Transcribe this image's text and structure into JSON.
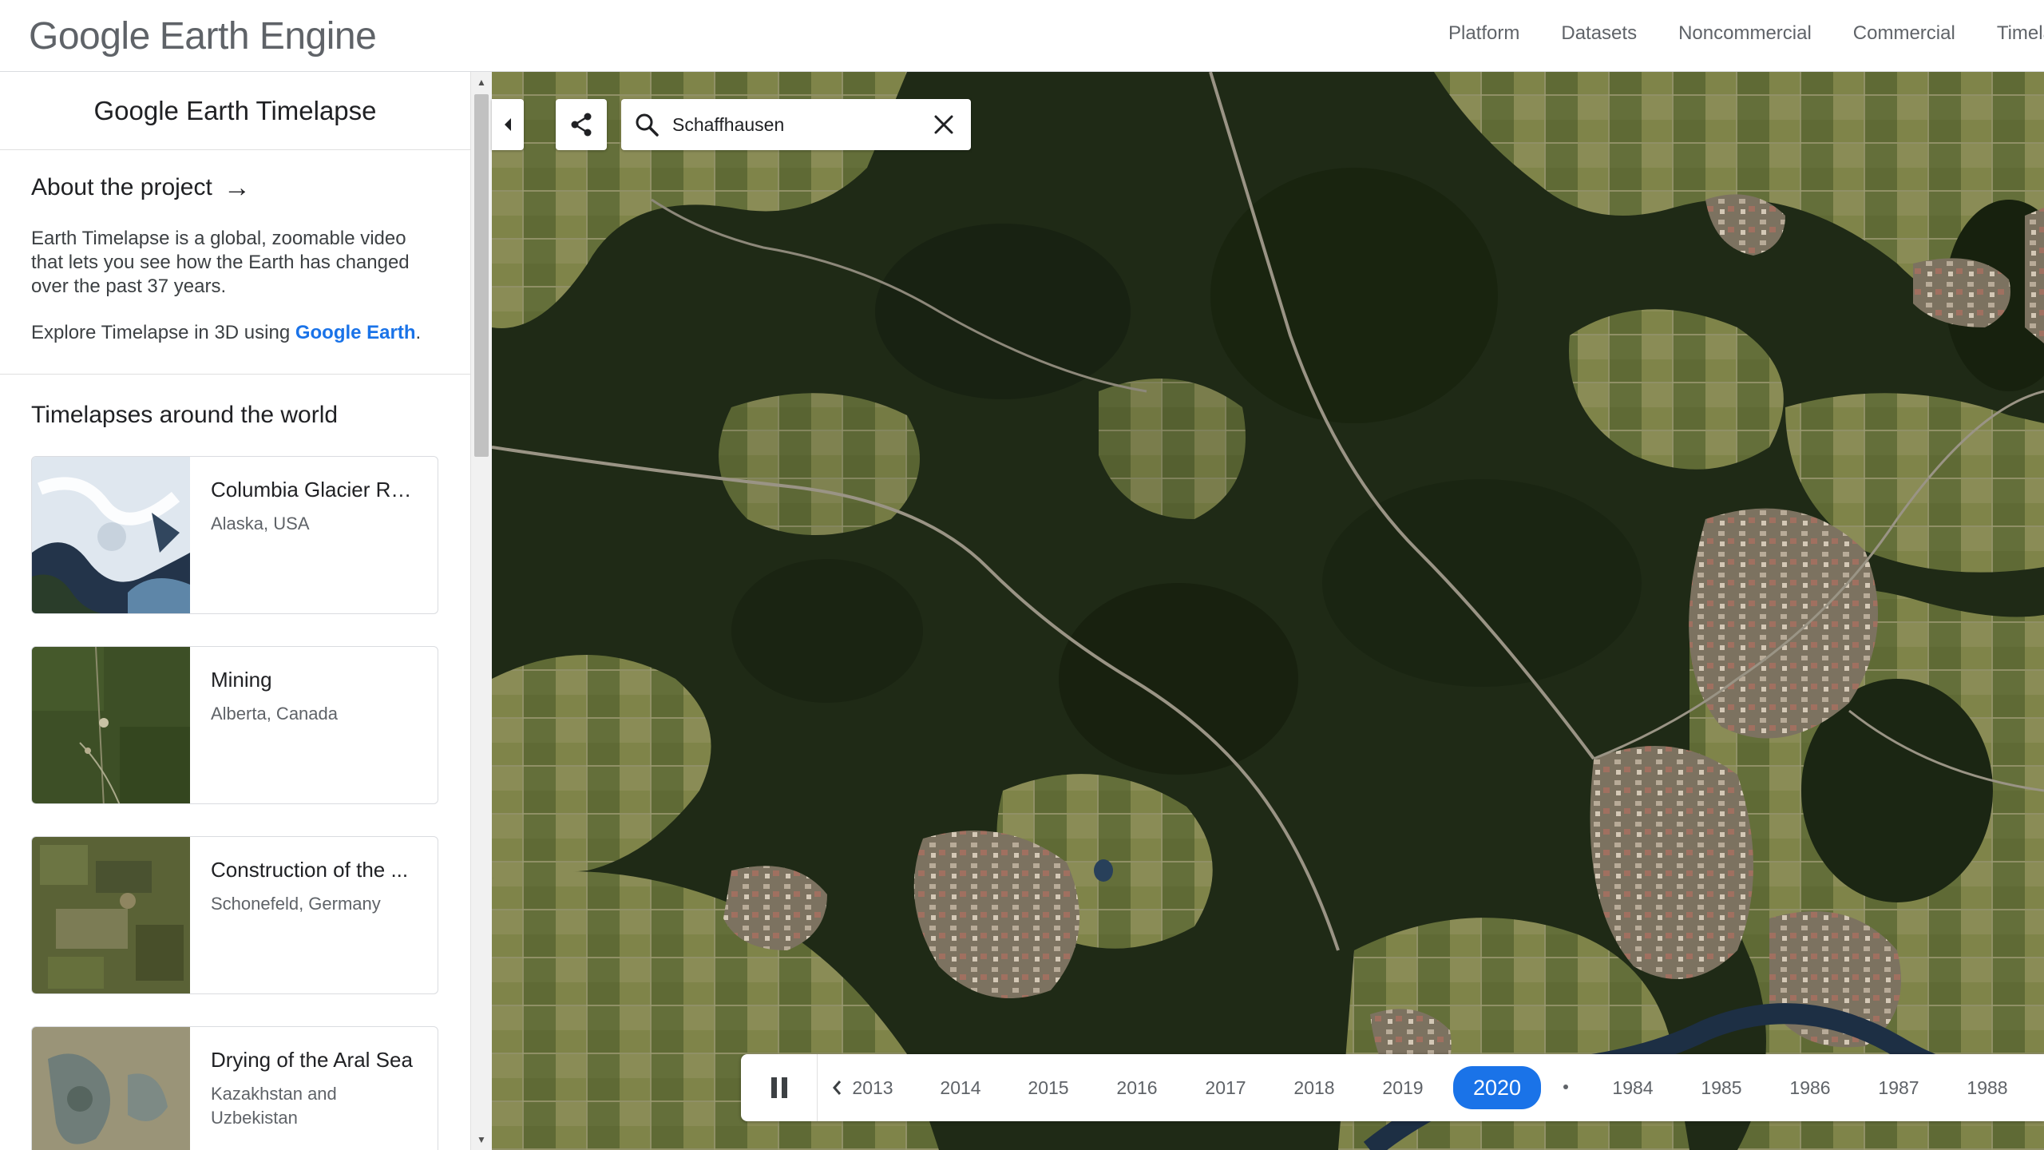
{
  "header": {
    "logo_google": "Google",
    "logo_product": "Earth Engine",
    "nav": [
      "Platform",
      "Datasets",
      "Noncommercial",
      "Commercial",
      "Timelapse"
    ]
  },
  "sidebar": {
    "title": "Google Earth Timelapse",
    "about": {
      "heading": "About the project",
      "body": "Earth Timelapse is a global, zoomable video that lets you see how the Earth has changed over the past 37 years.",
      "explore_prefix": "Explore Timelapse in 3D using ",
      "explore_link": "Google Earth",
      "explore_suffix": "."
    },
    "world_heading": "Timelapses around the world",
    "cards": [
      {
        "title": "Columbia Glacier Ret...",
        "subtitle": "Alaska, USA"
      },
      {
        "title": "Mining",
        "subtitle": "Alberta, Canada"
      },
      {
        "title": "Construction of the ...",
        "subtitle": "Schonefeld, Germany"
      },
      {
        "title": "Drying of the Aral Sea",
        "subtitle": "Kazakhstan and Uzbekistan"
      }
    ]
  },
  "map": {
    "search_value": "Schaffhausen"
  },
  "timeline": {
    "years_before": [
      "2013",
      "2014",
      "2015",
      "2016",
      "2017",
      "2018",
      "2019"
    ],
    "current_year": "2020",
    "years_after": [
      "1984",
      "1985",
      "1986",
      "1987",
      "1988"
    ]
  },
  "colors": {
    "accent": "#1a73e8",
    "forest": "#1f2a16",
    "field": "#7a7f4a"
  }
}
